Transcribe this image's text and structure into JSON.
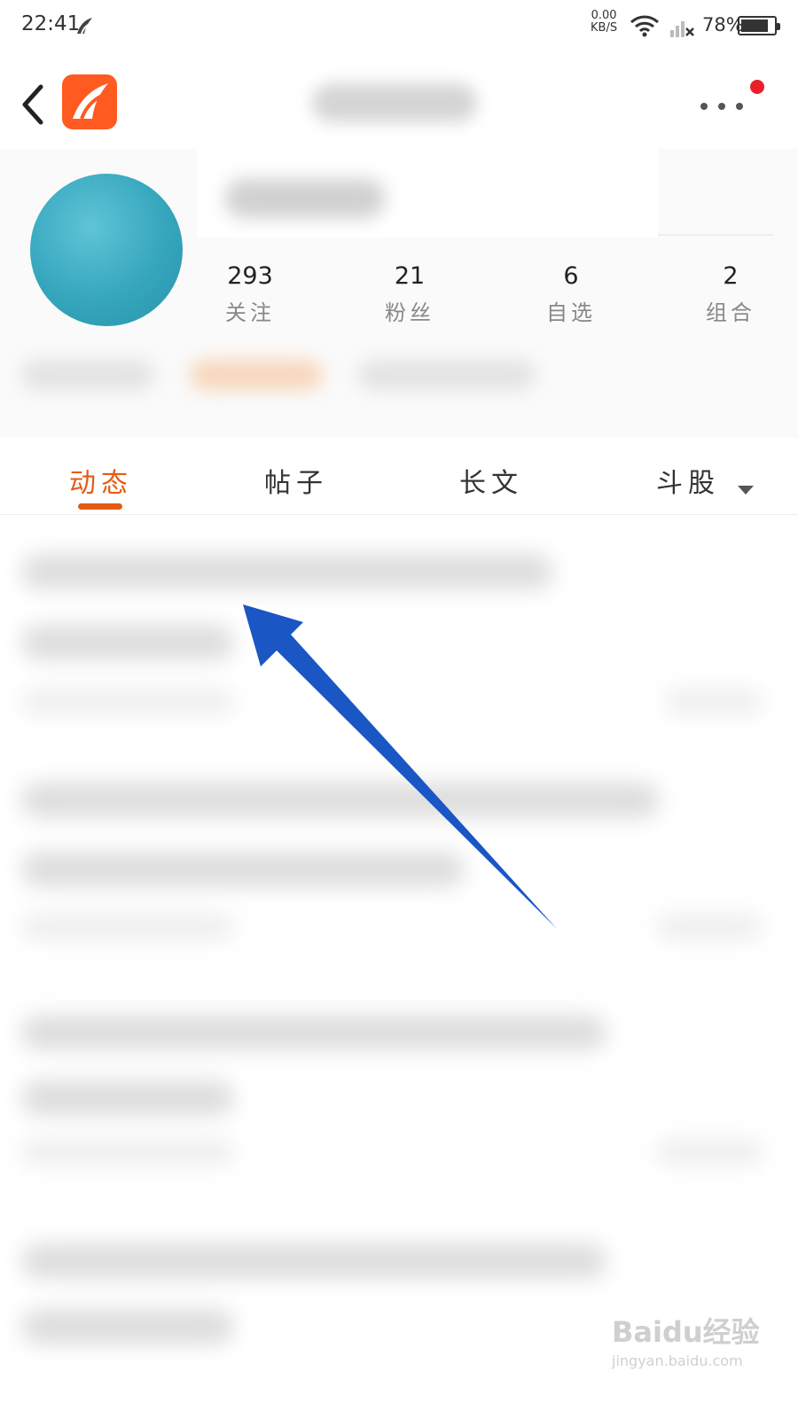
{
  "status_bar": {
    "time": "22:41",
    "net_speed_value": "0.00",
    "net_speed_unit": "KB/S",
    "battery_percent": "78%"
  },
  "nav": {
    "back_icon": "chevron-left-icon",
    "logo_icon": "app-logo-icon",
    "more_icon": "ellipsis-icon",
    "notification_color": "#e8202a",
    "brand_color": "#ff5a1f"
  },
  "profile": {
    "stats": [
      {
        "value": "293",
        "label": "关注"
      },
      {
        "value": "21",
        "label": "粉丝"
      },
      {
        "value": "6",
        "label": "自选"
      },
      {
        "value": "2",
        "label": "组合"
      }
    ]
  },
  "tabs": [
    {
      "label": "动态",
      "active": true
    },
    {
      "label": "帖子",
      "active": false
    },
    {
      "label": "长文",
      "active": false
    },
    {
      "label": "斗股",
      "active": false,
      "has_dropdown": true
    }
  ],
  "accent_color": "#e55a14",
  "annotation_arrow_color": "#1a56c4",
  "watermark": {
    "main": "Baidu经验",
    "url": "jingyan.baidu.com"
  }
}
